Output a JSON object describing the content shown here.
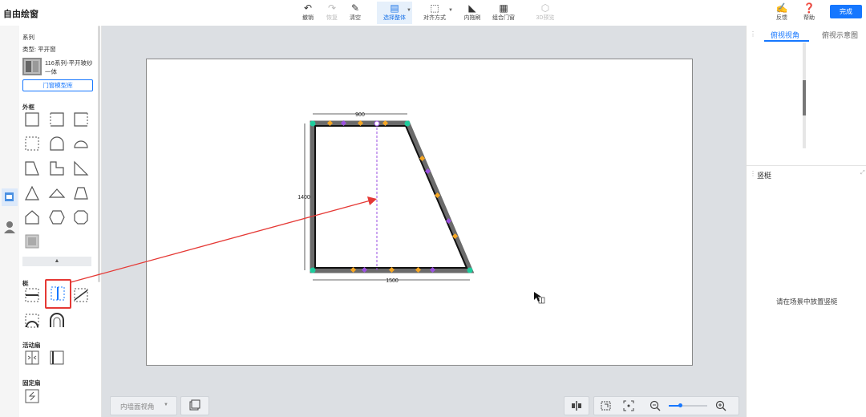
{
  "app": {
    "title": "自由绘窗"
  },
  "toolbar": {
    "undo": "撤销",
    "redo": "恢复",
    "clear": "清空",
    "select_all": "选择整体",
    "align": "对齐方式",
    "inner_open": "内拖刷",
    "combine": "组合门窗",
    "preview_3d": "3D预览",
    "feedback": "反馈",
    "help": "帮助",
    "done": "完成"
  },
  "left_panel": {
    "series_title": "系列",
    "type_label": "类型: 平开窗",
    "product_name": "116系列-平开玻纱一体",
    "library_button": "门窗模型库",
    "section_frame": "外框",
    "section_mullion": "梃",
    "section_active_sash": "活动扇",
    "section_fixed_sash": "固定扇"
  },
  "drawing": {
    "dim_top": "900",
    "dim_left": "1400",
    "dim_bottom": "1500"
  },
  "bottom_bar": {
    "view_select": "内墙面视角"
  },
  "right_panel": {
    "tabs": [
      "俯视视角",
      "俯视示意图"
    ],
    "section_title": "竖梃",
    "hint": "请在场景中放置竖梃"
  },
  "colors": {
    "accent": "#1677ff",
    "highlight": "#e53935",
    "green_node": "#1ecb9c",
    "orange_node": "#f5a623",
    "purple_node": "#9b51e0"
  }
}
